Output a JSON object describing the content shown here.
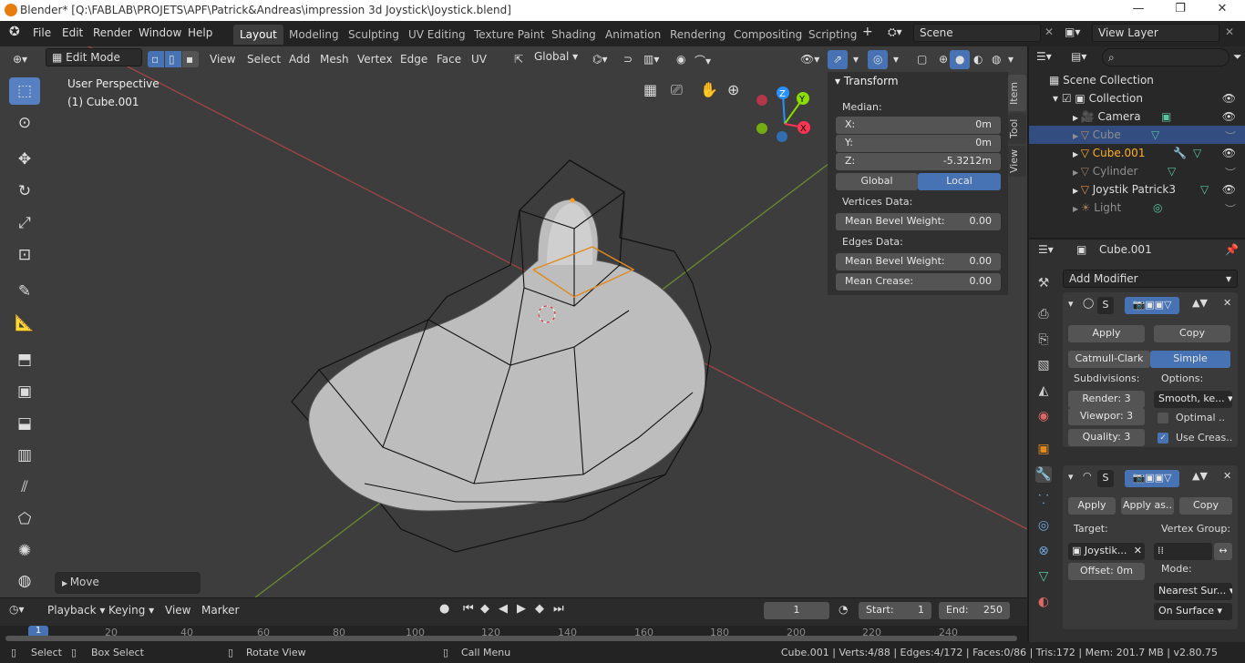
{
  "window": {
    "title": "Blender* [Q:\\FABLAB\\PROJETS\\APF\\Patrick&Andreas\\impression 3d Joystick\\Joystick.blend]",
    "controls": {
      "minimize": "—",
      "maximize": "❐",
      "close": "✕"
    }
  },
  "menubar": {
    "items": [
      "File",
      "Edit",
      "Render",
      "Window",
      "Help"
    ],
    "workspaces": [
      "Layout",
      "Modeling",
      "Sculpting",
      "UV Editing",
      "Texture Paint",
      "Shading",
      "Animation",
      "Rendering",
      "Compositing",
      "Scripting"
    ],
    "active_workspace": "Layout",
    "add_workspace": "+",
    "scene": "Scene",
    "view_layer": "View Layer"
  },
  "viewport_header": {
    "mode": "Edit Mode",
    "menus": [
      "View",
      "Select",
      "Add",
      "Mesh",
      "Vertex",
      "Edge",
      "Face",
      "UV"
    ],
    "orientation": "Global"
  },
  "viewport": {
    "perspective_label": "User Perspective",
    "object_label": "(1) Cube.001",
    "last_operator": "Move",
    "gizmo_axes": [
      "Z",
      "Y",
      "X"
    ]
  },
  "toolbar": {
    "tools": [
      "select-box",
      "cursor",
      "move",
      "rotate",
      "scale",
      "transform",
      "annotate",
      "measure",
      "extrude",
      "inset",
      "bevel",
      "loop-cut",
      "knife",
      "poly-build",
      "spin",
      "smooth",
      "shrink"
    ]
  },
  "n_panel": {
    "header": "Transform",
    "median_label": "Median:",
    "fields": [
      {
        "label": "X:",
        "value": "0m"
      },
      {
        "label": "Y:",
        "value": "0m"
      },
      {
        "label": "Z:",
        "value": "-5.3212m"
      }
    ],
    "toggle": {
      "global": "Global",
      "local": "Local",
      "active": "Local"
    },
    "vertices_data_label": "Vertices Data:",
    "vertex_bevel": {
      "label": "Mean Bevel Weight:",
      "value": "0.00"
    },
    "edges_data_label": "Edges Data:",
    "edge_bevel": {
      "label": "Mean Bevel Weight:",
      "value": "0.00"
    },
    "edge_crease": {
      "label": "Mean Crease:",
      "value": "0.00"
    },
    "tabs": [
      "Item",
      "Tool",
      "View"
    ]
  },
  "outliner": {
    "scene_collection": "Scene Collection",
    "collection": "Collection",
    "items": [
      {
        "name": "Camera",
        "selected": false,
        "dim": false,
        "visible": true
      },
      {
        "name": "Cube",
        "selected": true,
        "dim": true,
        "visible": false
      },
      {
        "name": "Cube.001",
        "selected": false,
        "dim": false,
        "active": true,
        "visible": true
      },
      {
        "name": "Cylinder",
        "selected": false,
        "dim": true,
        "visible": false
      },
      {
        "name": "Joystik Patrick3",
        "selected": false,
        "dim": false,
        "visible": true
      },
      {
        "name": "Light",
        "selected": false,
        "dim": true,
        "visible": false
      }
    ]
  },
  "properties": {
    "object_name": "Cube.001",
    "add_modifier": "Add Modifier",
    "subsurf": {
      "name_short": "S",
      "apply": "Apply",
      "copy": "Copy",
      "types": [
        "Catmull-Clark",
        "Simple"
      ],
      "active_type": "Simple",
      "subdivisions_label": "Subdivisions:",
      "options_label": "Options:",
      "render": {
        "label": "Render:",
        "value": "3"
      },
      "viewport": {
        "label": "Viewpor:",
        "value": "3"
      },
      "quality": {
        "label": "Quality:",
        "value": "3"
      },
      "smooth": "Smooth, ke...",
      "optimal": "Optimal ..",
      "optimal_checked": false,
      "use_creases": "Use Creas..",
      "use_creases_checked": true
    },
    "shrinkwrap": {
      "name_short": "S",
      "apply": "Apply",
      "apply_as": "Apply as..",
      "copy": "Copy",
      "target_label": "Target:",
      "target_value": "Joystik...",
      "vertex_group_label": "Vertex Group:",
      "offset": "Offset: 0m",
      "mode_label": "Mode:",
      "mode_value": "Nearest Sur...",
      "surface_value": "On Surface"
    }
  },
  "timeline": {
    "menus": [
      "Playback",
      "Keying",
      "View",
      "Marker"
    ],
    "current_frame": "1",
    "start": {
      "label": "Start:",
      "value": "1"
    },
    "end": {
      "label": "End:",
      "value": "250"
    },
    "ruler": [
      "20",
      "40",
      "60",
      "80",
      "100",
      "120",
      "140",
      "160",
      "180",
      "200",
      "220",
      "240"
    ],
    "playhead": "1"
  },
  "statusbar": {
    "select": "Select",
    "box_select": "Box Select",
    "rotate_view": "Rotate View",
    "call_menu": "Call Menu",
    "stats": "Cube.001 | Verts:4/88 | Edges:4/172 | Faces:0/86 | Tris:172 | Mem: 201.7 MB | v2.80.75"
  },
  "colors": {
    "accent": "#4772b3",
    "selected_row": "#334d80",
    "active_object": "#ffaf29",
    "viewport_bg": "#3d3d3d",
    "axis_x": "#ff3352",
    "axis_y": "#8bdc00",
    "axis_z": "#2890ff"
  }
}
